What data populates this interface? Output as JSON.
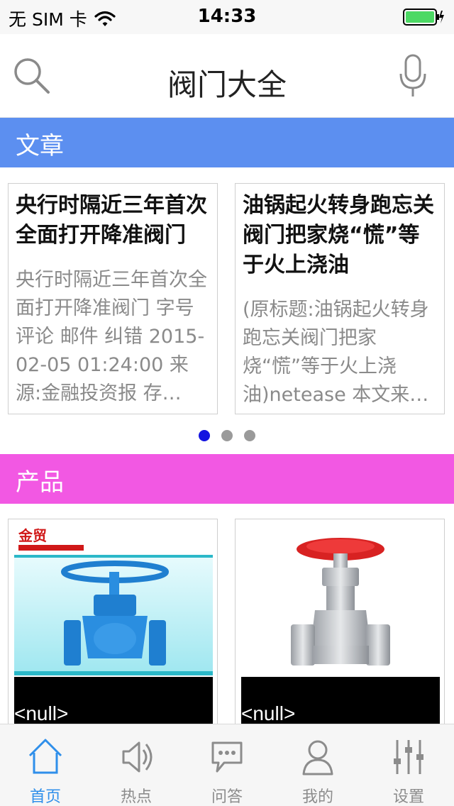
{
  "status_bar": {
    "carrier": "无 SIM 卡",
    "time": "14:33",
    "battery_color": "#4cd964"
  },
  "header": {
    "title": "阀门大全",
    "search_icon": "search-icon",
    "mic_icon": "microphone-icon"
  },
  "articles_section": {
    "label": "文章",
    "color": "#5c8ff0",
    "cards": [
      {
        "title": "央行时隔近三年首次全面打开降准阀门",
        "body": "央行时隔近三年首次全面打开降准阀门 字号 评论 邮件 纠错 2015-02-05 01:24:00 来源:金融投资报 存…"
      },
      {
        "title": "油锅起火转身跑忘关阀门把家烧“慌”等于火上浇油",
        "body": "(原标题:油锅起火转身跑忘关阀门把家烧“慌”等于火上浇油)netease 本文来…"
      }
    ],
    "pager": {
      "page_count": 3,
      "current": 1,
      "active_color": "#1414e0",
      "inactive_color": "#9a9a9a"
    }
  },
  "products_section": {
    "label": "产品",
    "color": "#f258e3",
    "cards": [
      {
        "caption": "<null>",
        "image": "blue-gate-valve-image",
        "brand_logo_text": "金贸"
      },
      {
        "caption": "<null>",
        "image": "stainless-gate-valve-image"
      }
    ]
  },
  "tab_bar": {
    "active_color": "#2f8fea",
    "inactive_color": "#8c8c8c",
    "tabs": [
      {
        "label": "首页",
        "icon": "home-icon",
        "active": true
      },
      {
        "label": "热点",
        "icon": "speaker-icon",
        "active": false
      },
      {
        "label": "问答",
        "icon": "chat-bubble-icon",
        "active": false
      },
      {
        "label": "我的",
        "icon": "user-icon",
        "active": false
      },
      {
        "label": "设置",
        "icon": "sliders-icon",
        "active": false
      }
    ]
  }
}
